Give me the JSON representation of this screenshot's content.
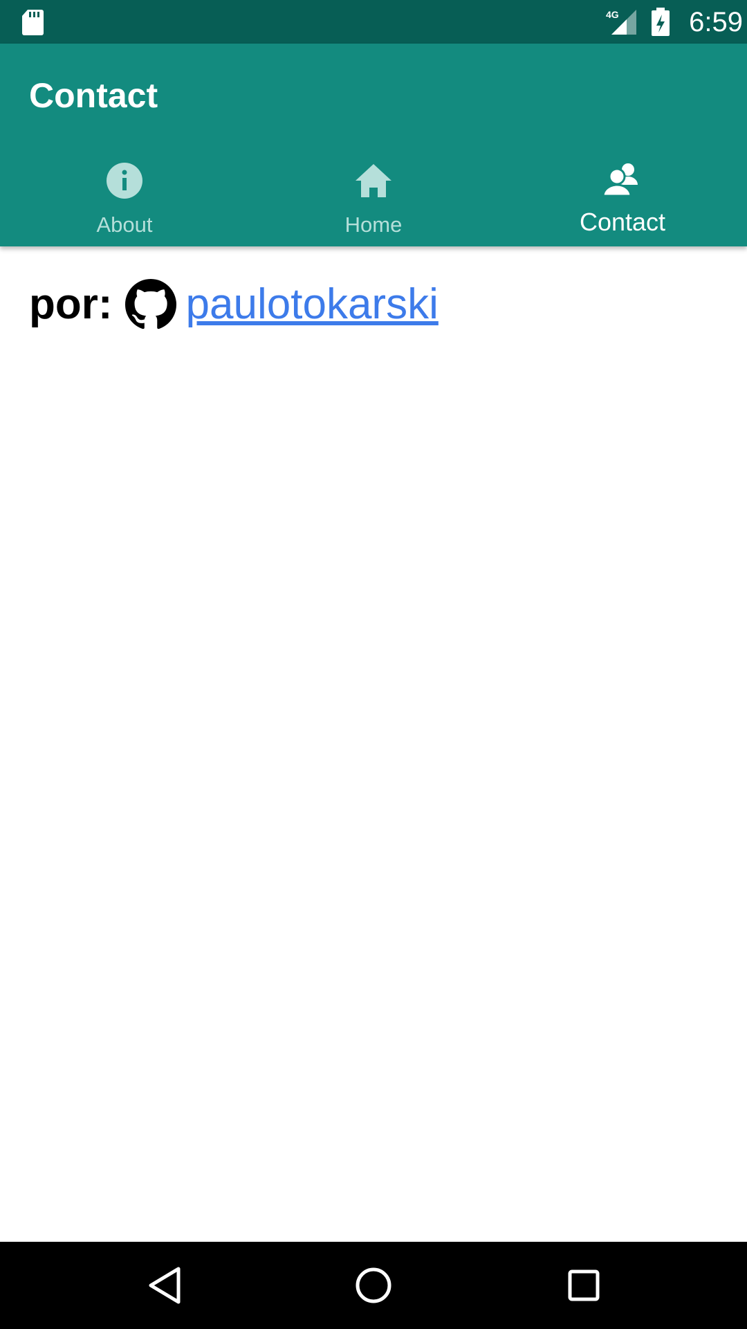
{
  "status_bar": {
    "time": "6:59",
    "network": "4G",
    "icons": [
      "sd-card-icon",
      "signal-icon",
      "battery-charging-icon"
    ]
  },
  "app_bar": {
    "title": "Contact",
    "tabs": [
      {
        "label": "About",
        "icon": "info-icon",
        "active": false
      },
      {
        "label": "Home",
        "icon": "home-icon",
        "active": false
      },
      {
        "label": "Contact",
        "icon": "contacts-icon",
        "active": true
      }
    ]
  },
  "content": {
    "by_label": "por:",
    "github_icon": "github-icon",
    "author": "paulotokarski"
  },
  "nav_bar": {
    "buttons": [
      "back-icon",
      "home-circle-icon",
      "recents-icon"
    ]
  },
  "colors": {
    "status_bar": "#075e55",
    "app_bar": "#138b7f",
    "inactive_tab": "#b5dfda",
    "link": "#3d7bea"
  }
}
